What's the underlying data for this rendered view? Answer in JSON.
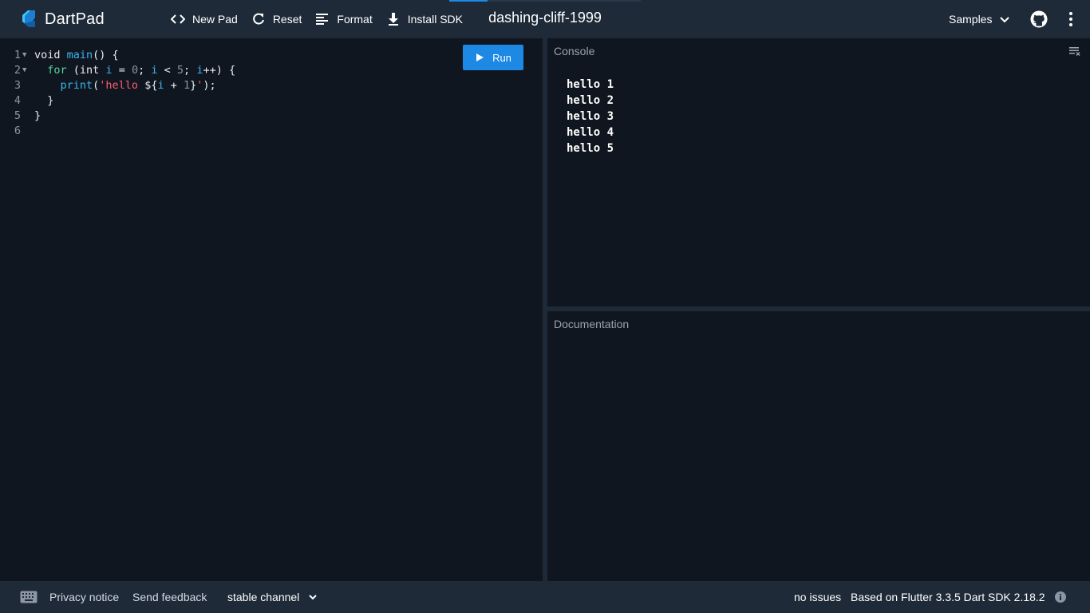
{
  "header": {
    "logo_text": "DartPad",
    "toolbar": [
      {
        "label": "New Pad",
        "icon": "code-brackets-icon"
      },
      {
        "label": "Reset",
        "icon": "refresh-icon"
      },
      {
        "label": "Format",
        "icon": "format-lines-icon"
      },
      {
        "label": "Install SDK",
        "icon": "download-icon"
      }
    ],
    "pad_title": "dashing-cliff-1999",
    "samples_label": "Samples",
    "loading_progress": 0.2
  },
  "editor": {
    "run_label": "Run",
    "lines": [
      {
        "number": "1",
        "foldable": true,
        "tokens": [
          {
            "t": "void ",
            "c": ""
          },
          {
            "t": "main",
            "c": "fn"
          },
          {
            "t": "() {",
            "c": ""
          }
        ]
      },
      {
        "number": "2",
        "foldable": true,
        "tokens": [
          {
            "t": "  ",
            "c": ""
          },
          {
            "t": "for",
            "c": "kw"
          },
          {
            "t": " (int ",
            "c": ""
          },
          {
            "t": "i",
            "c": "var"
          },
          {
            "t": " = ",
            "c": ""
          },
          {
            "t": "0",
            "c": "num"
          },
          {
            "t": "; ",
            "c": ""
          },
          {
            "t": "i",
            "c": "var"
          },
          {
            "t": " < ",
            "c": ""
          },
          {
            "t": "5",
            "c": "num"
          },
          {
            "t": "; ",
            "c": ""
          },
          {
            "t": "i",
            "c": "var"
          },
          {
            "t": "++) {",
            "c": ""
          }
        ]
      },
      {
        "number": "3",
        "foldable": false,
        "tokens": [
          {
            "t": "    ",
            "c": ""
          },
          {
            "t": "print",
            "c": "fn"
          },
          {
            "t": "(",
            "c": ""
          },
          {
            "t": "'hello ",
            "c": "str"
          },
          {
            "t": "${",
            "c": ""
          },
          {
            "t": "i",
            "c": "var"
          },
          {
            "t": " + ",
            "c": ""
          },
          {
            "t": "1",
            "c": "num"
          },
          {
            "t": "}",
            "c": ""
          },
          {
            "t": "'",
            "c": "str"
          },
          {
            "t": ");",
            "c": ""
          }
        ]
      },
      {
        "number": "4",
        "foldable": false,
        "tokens": [
          {
            "t": "  }",
            "c": ""
          }
        ]
      },
      {
        "number": "5",
        "foldable": false,
        "tokens": [
          {
            "t": "}",
            "c": ""
          }
        ]
      },
      {
        "number": "6",
        "foldable": false,
        "tokens": []
      }
    ]
  },
  "console": {
    "title": "Console",
    "output": [
      "hello 1",
      "hello 2",
      "hello 3",
      "hello 4",
      "hello 5"
    ]
  },
  "documentation": {
    "title": "Documentation"
  },
  "footer": {
    "privacy": "Privacy notice",
    "feedback": "Send feedback",
    "channel": "stable channel",
    "issues": "no issues",
    "sdk_info": "Based on Flutter 3.3.5 Dart SDK 2.18.2"
  },
  "colors": {
    "accent": "#1e88e5",
    "header_bg": "#1e2a38",
    "editor_bg": "#0f161f",
    "keyword": "#59d7a0",
    "function": "#3cb5f0",
    "string": "#ff5c6c"
  }
}
